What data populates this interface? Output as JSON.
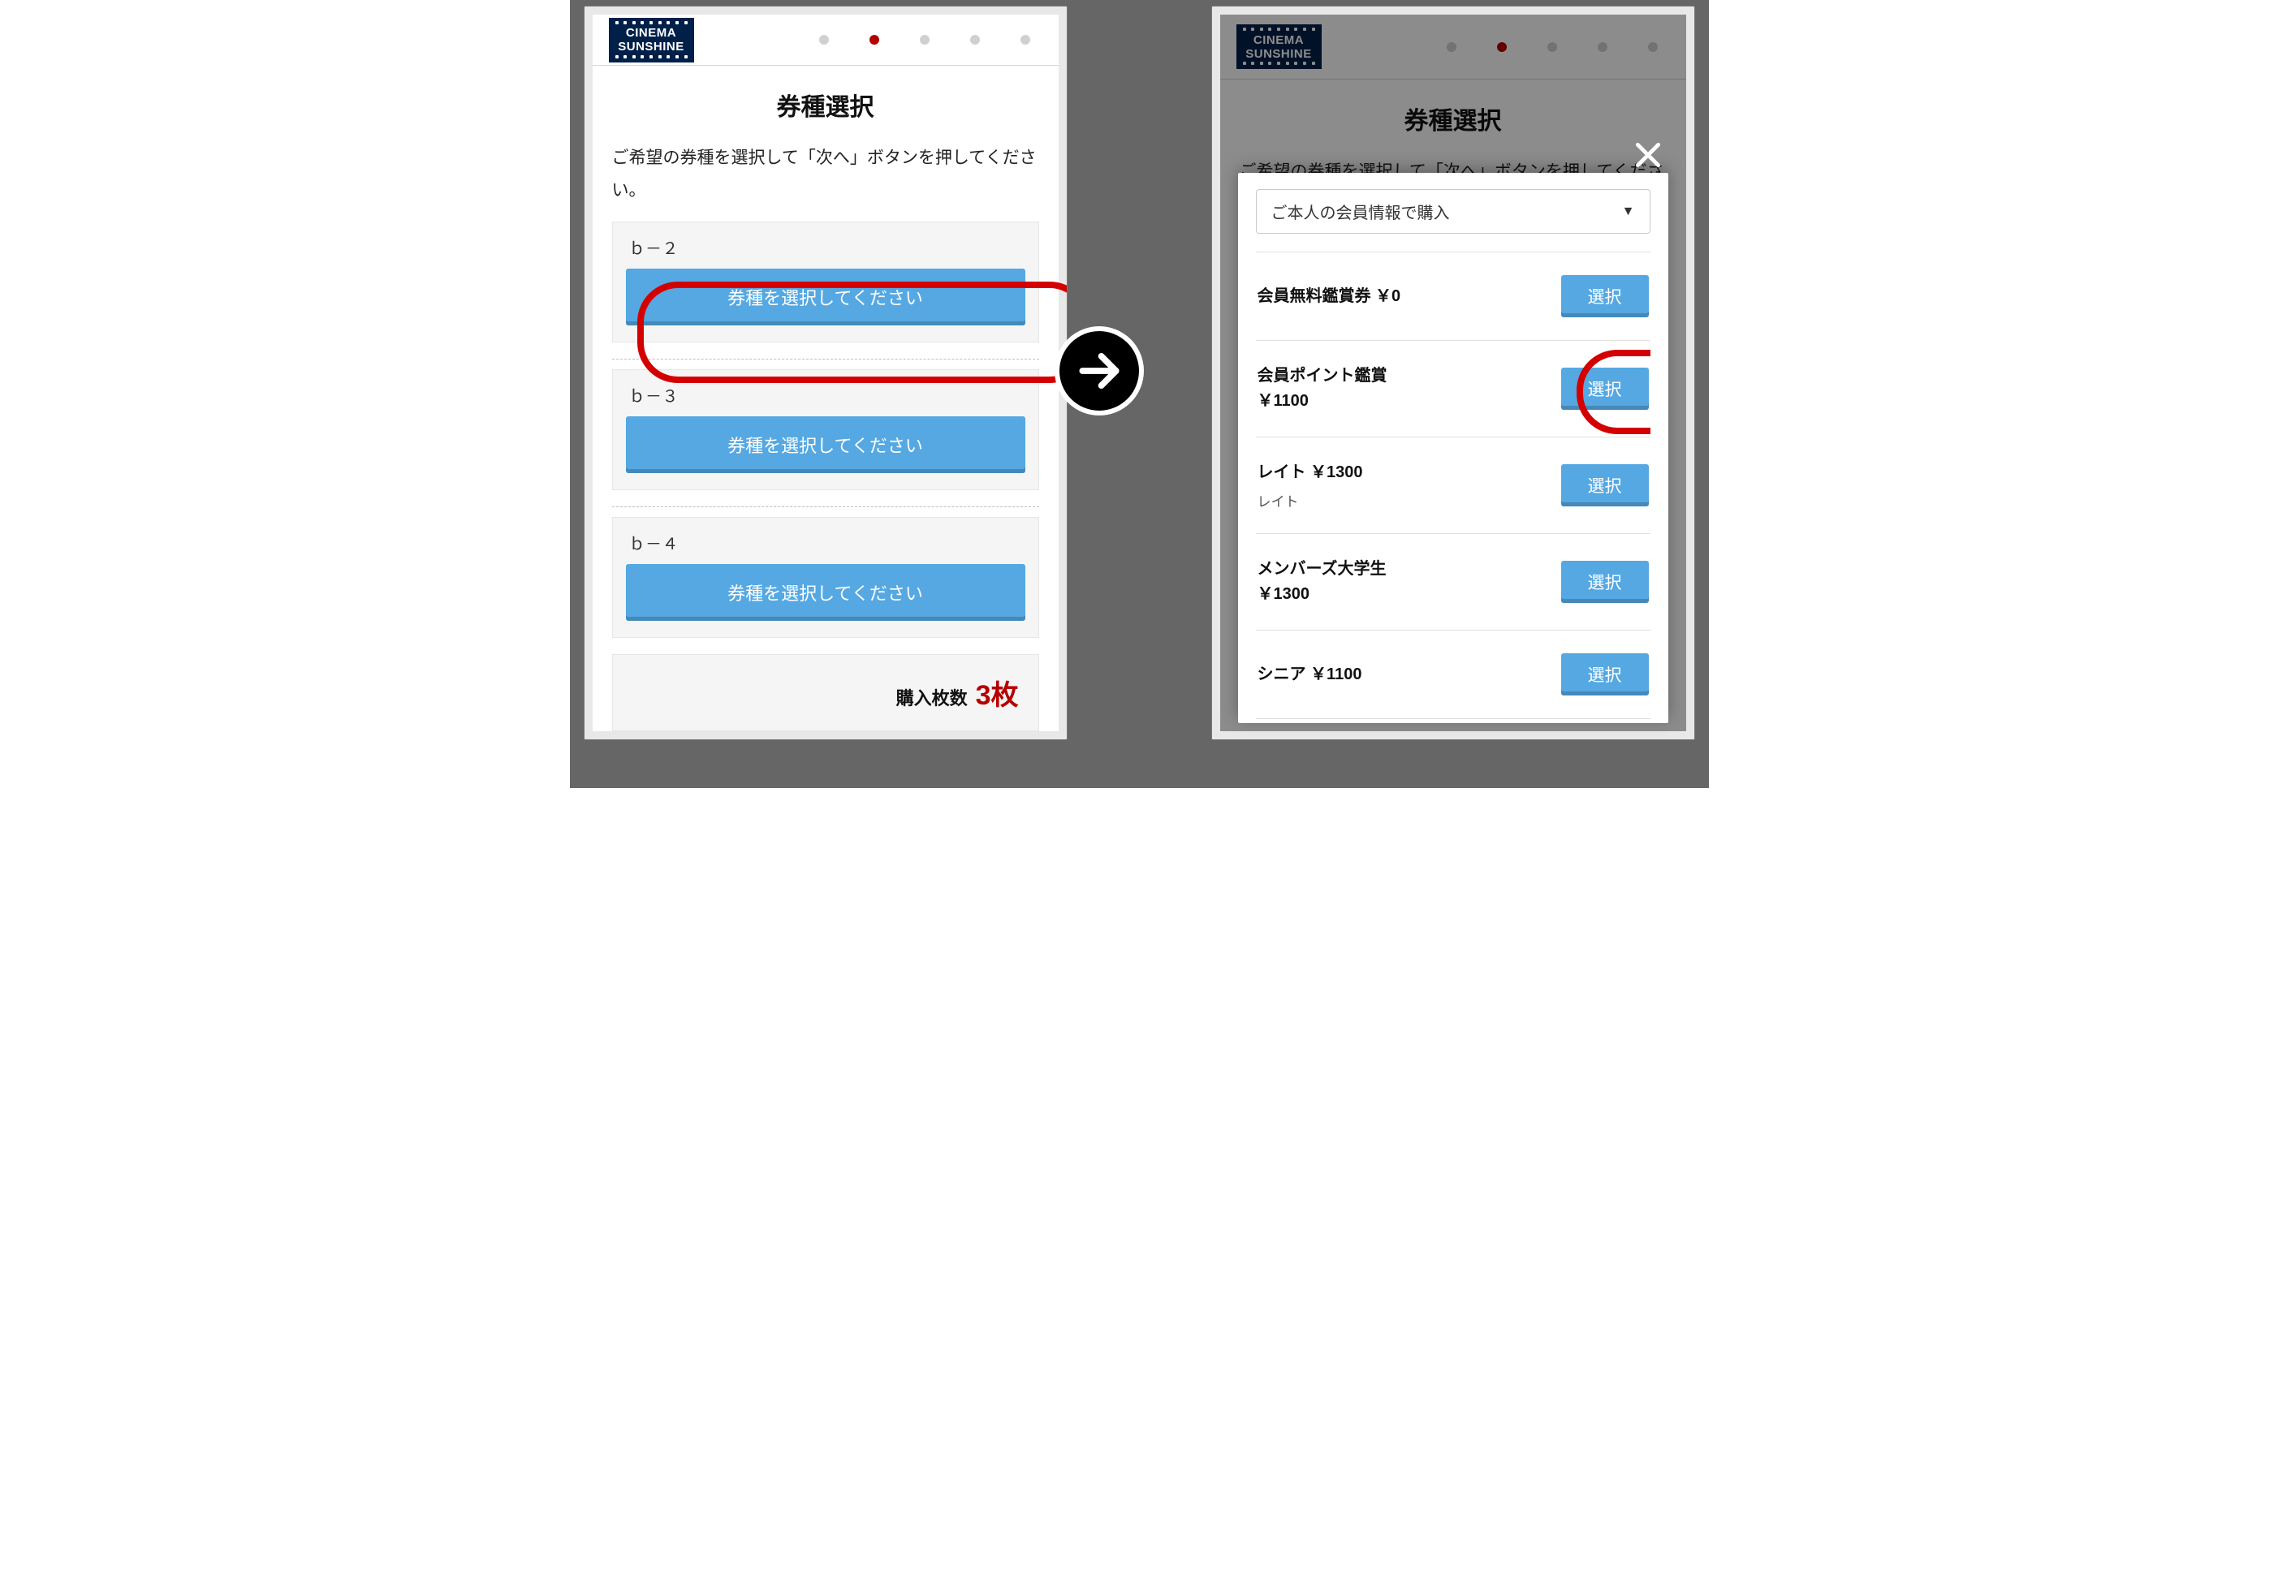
{
  "logo_line1": "CINEMA",
  "logo_line2": "SUNSHINE",
  "section_title": "券種選択",
  "description": "ご希望の券種を選択して「次へ」ボタンを押してください。",
  "select_prompt": "券種を選択してください",
  "seats": {
    "s0": "ｂ－２",
    "s1": "ｂ－３",
    "s2": "ｂ－４"
  },
  "footer_label": "購入枚数",
  "footer_count": "3枚",
  "select_label": "選択",
  "purchase_type_select": "ご本人の会員情報で購入",
  "prices": {
    "p0": {
      "name": "会員無料鑑賞券 ￥0"
    },
    "p1": {
      "name1": "会員ポイント鑑賞",
      "name2": "￥1100"
    },
    "p2": {
      "name": "レイト ￥1300",
      "sub": "レイト"
    },
    "p3": {
      "name1": "メンバーズ大学生",
      "name2": "￥1300"
    },
    "p4": {
      "name": "シニア ￥1100"
    }
  },
  "colors": {
    "accent": "#55a8e2",
    "emph": "#b60000"
  }
}
